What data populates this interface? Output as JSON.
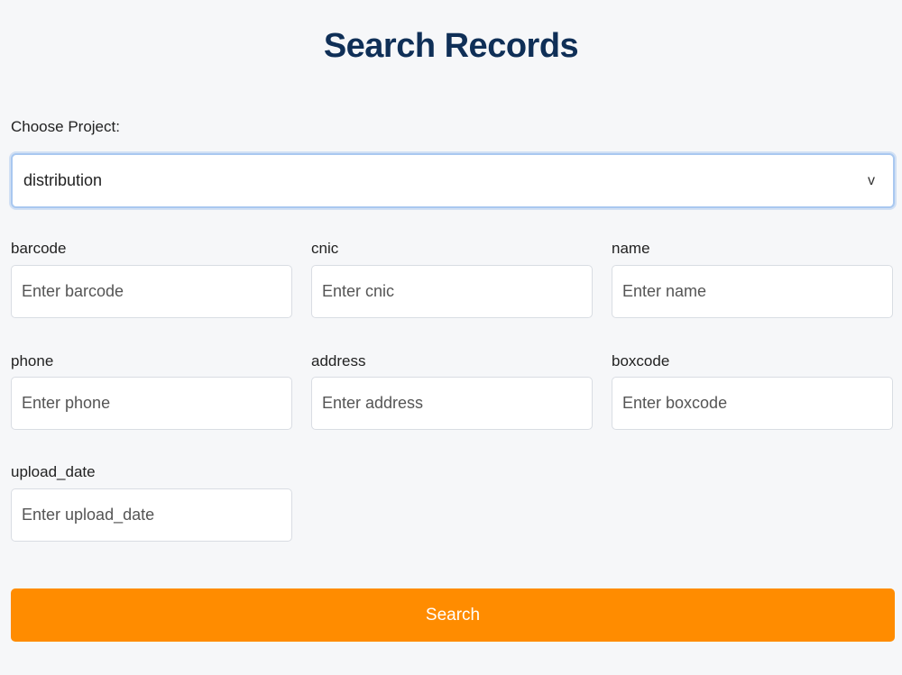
{
  "page": {
    "title": "Search Records"
  },
  "project": {
    "label": "Choose Project:",
    "selected": "distribution",
    "chevron": "v"
  },
  "fields": [
    {
      "label": "barcode",
      "placeholder": "Enter barcode",
      "value": ""
    },
    {
      "label": "cnic",
      "placeholder": "Enter cnic",
      "value": ""
    },
    {
      "label": "name",
      "placeholder": "Enter name",
      "value": ""
    },
    {
      "label": "phone",
      "placeholder": "Enter phone",
      "value": ""
    },
    {
      "label": "address",
      "placeholder": "Enter address",
      "value": ""
    },
    {
      "label": "boxcode",
      "placeholder": "Enter boxcode",
      "value": ""
    },
    {
      "label": "upload_date",
      "placeholder": "Enter upload_date",
      "value": ""
    }
  ],
  "actions": {
    "search_label": "Search"
  },
  "colors": {
    "title": "#0f2f57",
    "accent": "#ff8c00",
    "background": "#f6f7f9",
    "select_focus_border": "#a9c8f0"
  }
}
